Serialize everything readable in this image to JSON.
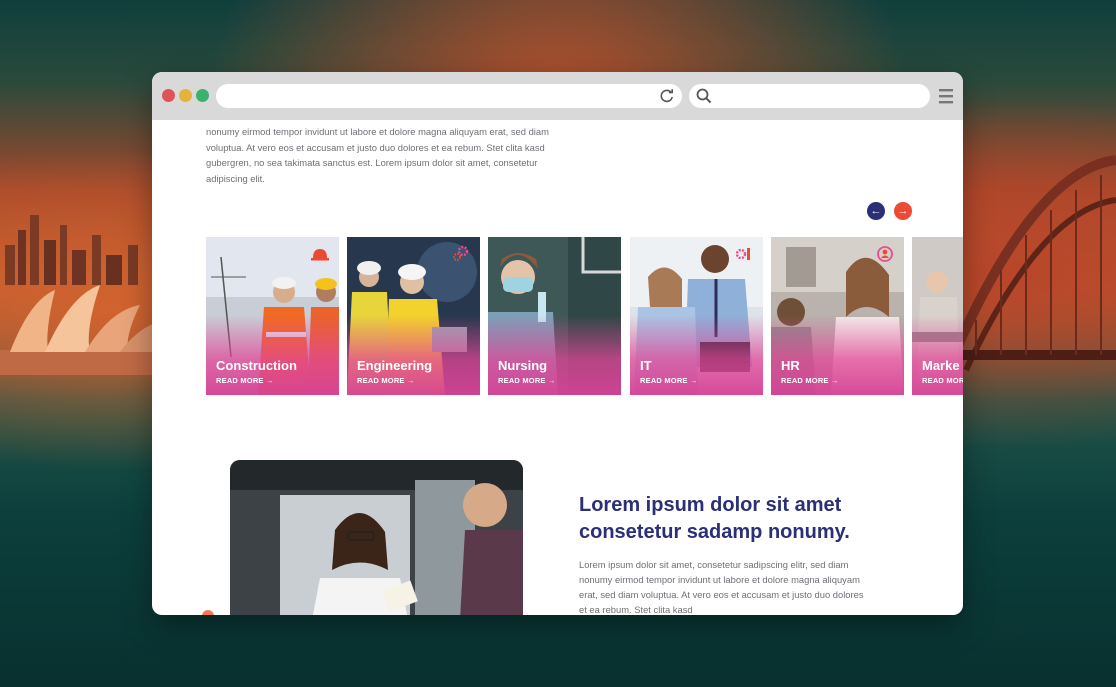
{
  "page": {
    "intro_text": "nonumy eirmod tempor invidunt ut labore et dolore magna aliquyam erat, sed diam voluptua. At vero eos et accusam et justo duo dolores et ea rebum. Stet clita kasd gubergren, no sea takimata sanctus est. Lorem ipsum dolor sit amet, consetetur adipiscing elit."
  },
  "carousel": {
    "prev_icon": "arrow-left-icon",
    "next_icon": "arrow-right-icon",
    "prev_symbol": "←",
    "next_symbol": "→",
    "cards": [
      {
        "title": "Construction",
        "more": "READ MORE →",
        "icon": "helmet-icon"
      },
      {
        "title": "Engineering",
        "more": "READ MORE →",
        "icon": "gears-icon"
      },
      {
        "title": "Nursing",
        "more": "READ MORE →",
        "icon": ""
      },
      {
        "title": "IT",
        "more": "READ MORE →",
        "icon": "code-icon"
      },
      {
        "title": "HR",
        "more": "READ MORE →",
        "icon": "person-search-icon"
      },
      {
        "title": "Marke",
        "more": "READ MOR",
        "icon": ""
      }
    ]
  },
  "feature": {
    "heading": "Lorem ipsum dolor sit amet consetetur sadamp nonumy.",
    "text": "Lorem ipsum dolor sit amet, consetetur sadipscing elitr, sed diam nonumy eirmod tempor invidunt ut labore et dolore magna aliquyam erat, sed diam voluptua. At vero eos et accusam et justo duo dolores et ea rebum. Stet clita kasd"
  },
  "colors": {
    "brand_navy": "#2b2f78",
    "brand_orange": "#ec4a33",
    "card_gradient": "#d6429b"
  }
}
